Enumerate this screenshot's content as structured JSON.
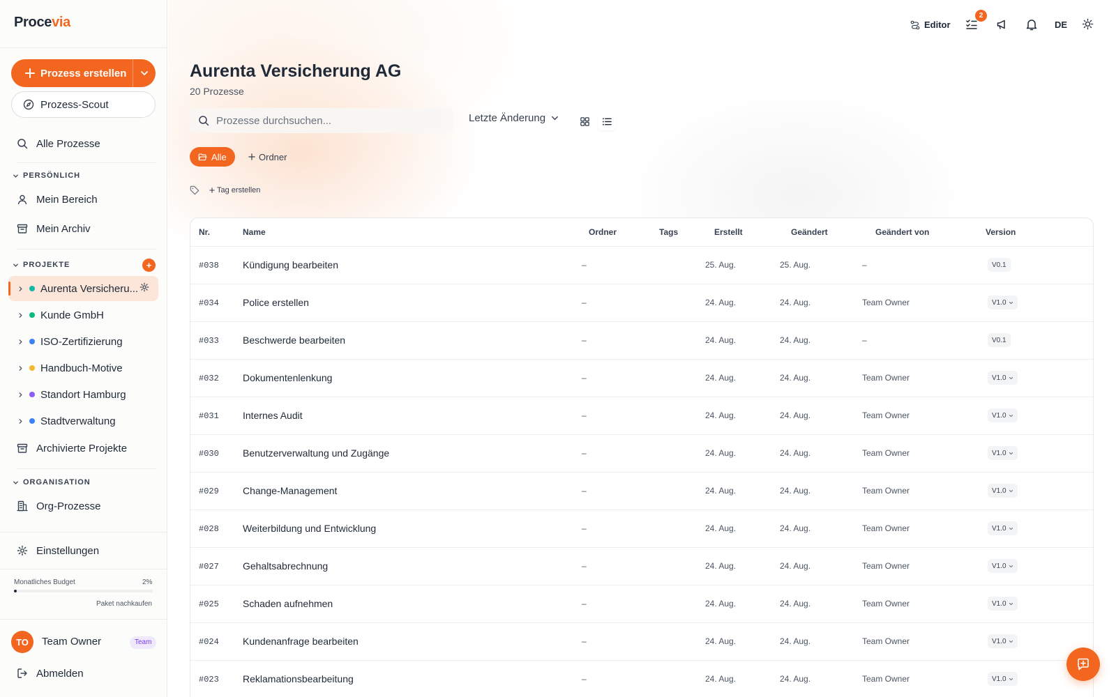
{
  "app": {
    "logo_a": "Proce",
    "logo_b": "via"
  },
  "sidebar": {
    "create_label": "Prozess erstellen",
    "scout_label": "Prozess-Scout",
    "all_processes": "Alle Prozesse",
    "personal_heading": "PERSÖNLICH",
    "my_area": "Mein Bereich",
    "my_archive": "Mein Archiv",
    "projects_heading": "PROJEKTE",
    "add_project_label": "+",
    "projects": [
      {
        "label": "Aurenta Versicheru...",
        "color": "#14b8a6"
      },
      {
        "label": "Kunde GmbH",
        "color": "#10b981"
      },
      {
        "label": "ISO-Zertifizierung",
        "color": "#3b82f6"
      },
      {
        "label": "Handbuch-Motive",
        "color": "#f5b82e"
      },
      {
        "label": "Standort Hamburg",
        "color": "#8b5cf6"
      },
      {
        "label": "Stadtverwaltung",
        "color": "#3b82f6"
      }
    ],
    "archived_projects": "Archivierte Projekte",
    "org_heading": "ORGANISATION",
    "org_processes": "Org-Prozesse",
    "settings": "Einstellungen",
    "budget_label": "Monatliches Budget",
    "budget_pct": "2%",
    "budget_value": 0.02,
    "buy_package": "Paket nachkaufen",
    "user_initials": "TO",
    "user_name": "Team Owner",
    "user_badge": "Team",
    "logout": "Abmelden"
  },
  "topbar": {
    "editor_label": "Editor",
    "tasks_badge": "2",
    "language": "DE"
  },
  "main": {
    "title": "Aurenta Versicherung AG",
    "subtitle": "20 Prozesse",
    "search_placeholder": "Prozesse durchsuchen...",
    "sort_label": "Letzte Änderung",
    "chip_all": "Alle",
    "chip_folder": "Ordner",
    "tag_create": "Tag erstellen"
  },
  "table": {
    "headers": {
      "nr": "Nr.",
      "name": "Name",
      "folder": "Ordner",
      "tags": "Tags",
      "created": "Erstellt",
      "changed": "Geändert",
      "changed_by": "Geändert von",
      "version": "Version"
    },
    "rows": [
      {
        "nr": "#038",
        "name": "Kündigung bearbeiten",
        "folder": "–",
        "created": "25. Aug.",
        "changed": "25. Aug.",
        "by": "–",
        "version": "V0.1",
        "ver_dropdown": false
      },
      {
        "nr": "#034",
        "name": "Police erstellen",
        "folder": "–",
        "created": "24. Aug.",
        "changed": "24. Aug.",
        "by": "Team Owner",
        "version": "V1.0",
        "ver_dropdown": true
      },
      {
        "nr": "#033",
        "name": "Beschwerde bearbeiten",
        "folder": "–",
        "created": "24. Aug.",
        "changed": "24. Aug.",
        "by": "–",
        "version": "V0.1",
        "ver_dropdown": false
      },
      {
        "nr": "#032",
        "name": "Dokumentenlenkung",
        "folder": "–",
        "created": "24. Aug.",
        "changed": "24. Aug.",
        "by": "Team Owner",
        "version": "V1.0",
        "ver_dropdown": true
      },
      {
        "nr": "#031",
        "name": "Internes Audit",
        "folder": "–",
        "created": "24. Aug.",
        "changed": "24. Aug.",
        "by": "Team Owner",
        "version": "V1.0",
        "ver_dropdown": true
      },
      {
        "nr": "#030",
        "name": "Benutzerverwaltung und Zugänge",
        "folder": "–",
        "created": "24. Aug.",
        "changed": "24. Aug.",
        "by": "Team Owner",
        "version": "V1.0",
        "ver_dropdown": true
      },
      {
        "nr": "#029",
        "name": "Change-Management",
        "folder": "–",
        "created": "24. Aug.",
        "changed": "24. Aug.",
        "by": "Team Owner",
        "version": "V1.0",
        "ver_dropdown": true
      },
      {
        "nr": "#028",
        "name": "Weiterbildung und Entwicklung",
        "folder": "–",
        "created": "24. Aug.",
        "changed": "24. Aug.",
        "by": "Team Owner",
        "version": "V1.0",
        "ver_dropdown": true
      },
      {
        "nr": "#027",
        "name": "Gehaltsabrechnung",
        "folder": "–",
        "created": "24. Aug.",
        "changed": "24. Aug.",
        "by": "Team Owner",
        "version": "V1.0",
        "ver_dropdown": true
      },
      {
        "nr": "#025",
        "name": "Schaden aufnehmen",
        "folder": "–",
        "created": "24. Aug.",
        "changed": "24. Aug.",
        "by": "Team Owner",
        "version": "V1.0",
        "ver_dropdown": true
      },
      {
        "nr": "#024",
        "name": "Kundenanfrage bearbeiten",
        "folder": "–",
        "created": "24. Aug.",
        "changed": "24. Aug.",
        "by": "Team Owner",
        "version": "V1.0",
        "ver_dropdown": true
      },
      {
        "nr": "#023",
        "name": "Reklamationsbearbeitung",
        "folder": "–",
        "created": "24. Aug.",
        "changed": "24. Aug.",
        "by": "Team Owner",
        "version": "V1.0",
        "ver_dropdown": true
      }
    ]
  },
  "colors": {
    "accent": "#f2661f",
    "text": "#1f2937",
    "badge_purple": "#7c3aed"
  }
}
